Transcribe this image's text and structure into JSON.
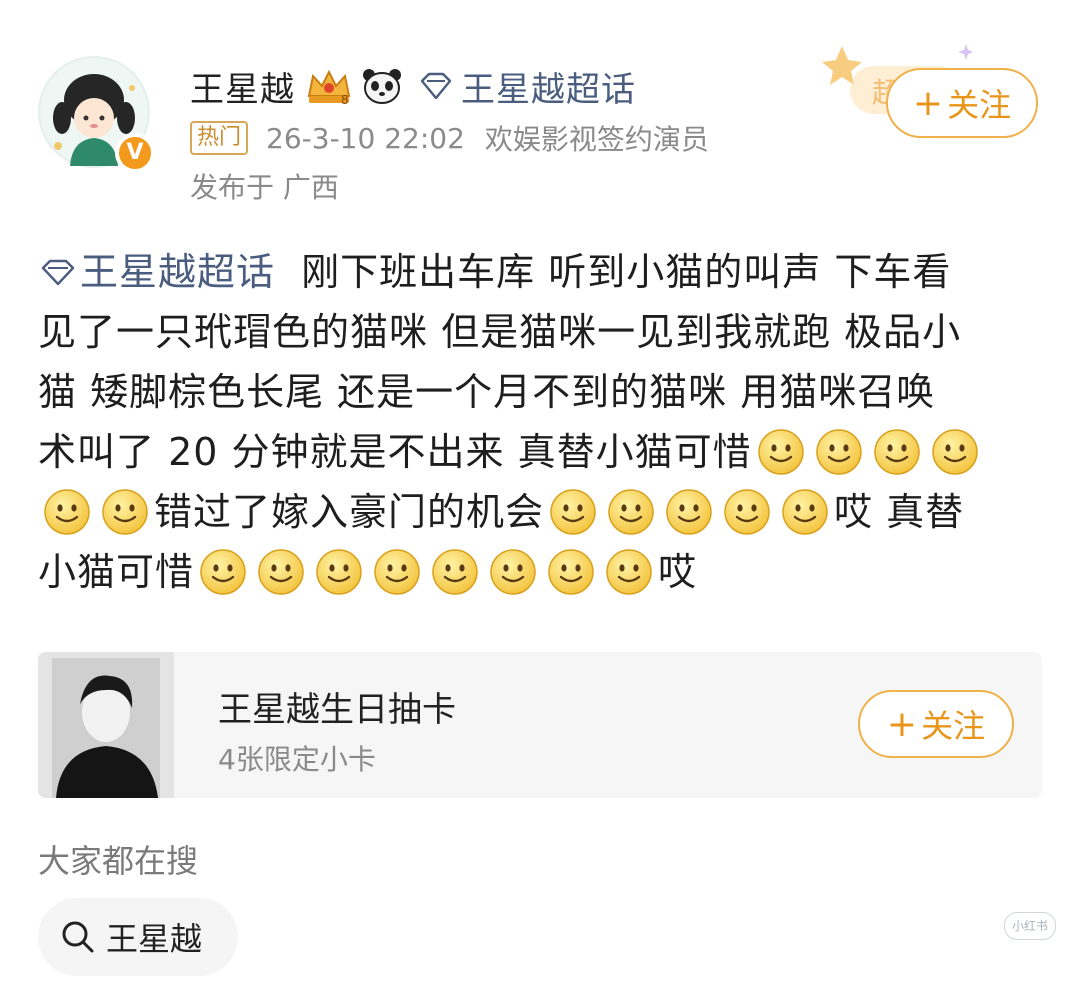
{
  "header": {
    "user_name": "王星越",
    "topic_name": "王星越超话",
    "hot_tag": "热门",
    "time": "26-3-10 22:02",
    "source": "欢娱影视签约演员",
    "location": "发布于 广西",
    "follow_label": "关注",
    "badge_text": "超"
  },
  "post": {
    "topic_link": "王星越超话",
    "lines": [
      [
        "  刚下班出车库 听到小猫的叫声 下车看"
      ],
      [
        "见了一只玳瑁色的猫咪 但是猫咪一见到我就跑 极品小"
      ],
      [
        "猫 矮脚棕色长尾 还是一个月不到的猫咪 用猫咪召唤"
      ],
      [
        "术叫了 20 分钟就是不出来 真替小猫可惜"
      ],
      [
        "错过了嫁入豪门的机会",
        "哎 真替"
      ],
      [
        "小猫可惜",
        "哎"
      ]
    ]
  },
  "card": {
    "title": "王星越生日抽卡",
    "subtitle": "4张限定小卡",
    "follow_label": "关注"
  },
  "search": {
    "heading": "大家都在搜",
    "chip": "王星越"
  },
  "watermark": "小红书",
  "colors": {
    "accent": "#e8951a",
    "topic": "#4a5d7e",
    "meta": "#8a8a8a",
    "hot_border": "#d8a658"
  },
  "icons": [
    "crown-icon",
    "panda-icon",
    "diamond-icon",
    "smile-emoji-icon",
    "search-icon"
  ]
}
